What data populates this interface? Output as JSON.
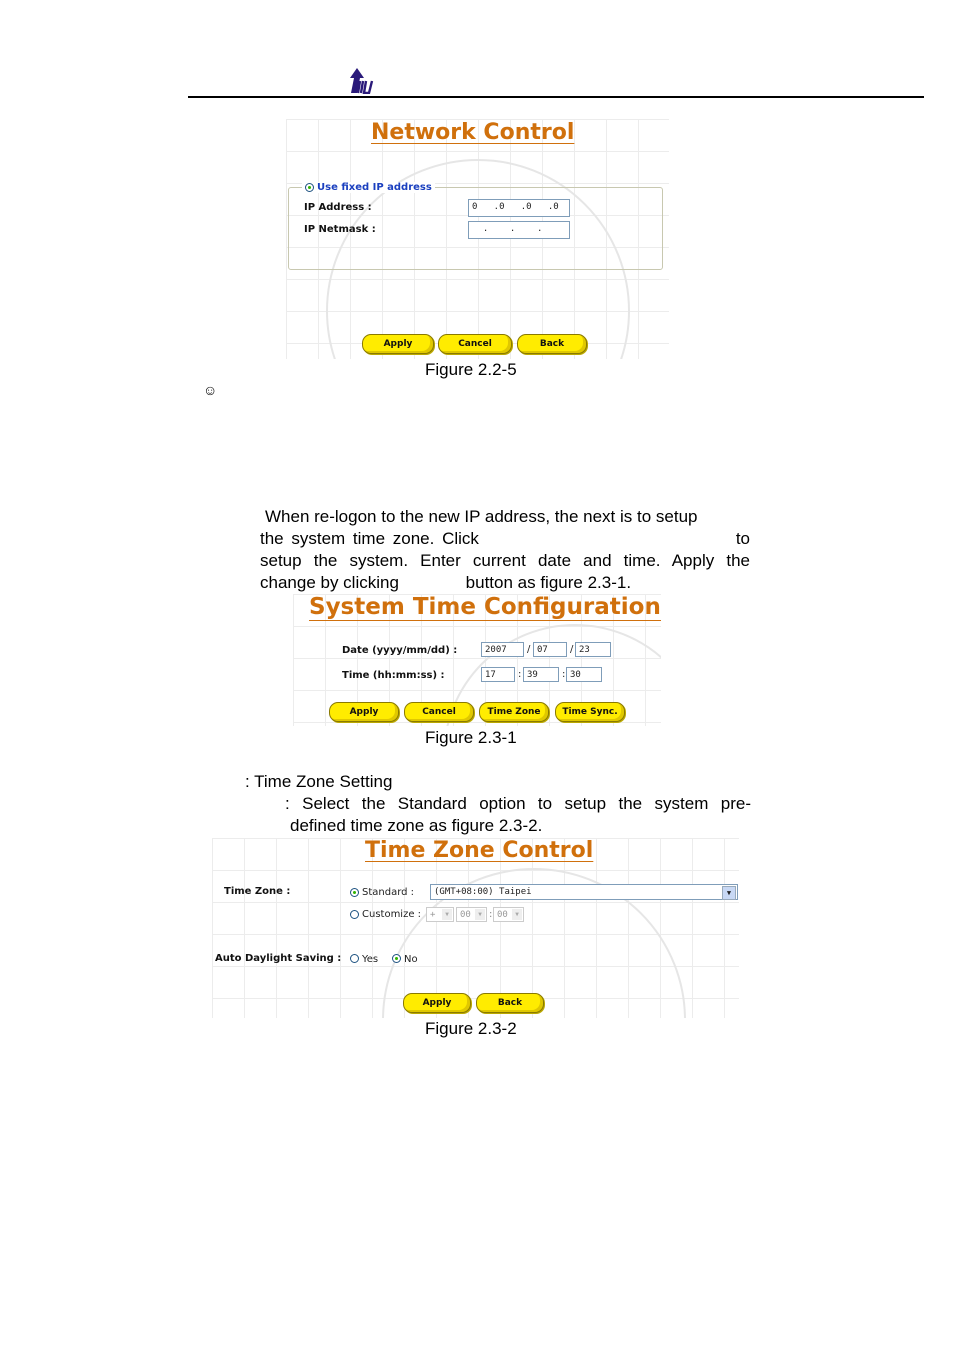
{
  "header": {
    "logo_icon": "tw-arrow-logo"
  },
  "figure_2_2_5": {
    "title": "Network Control",
    "fieldset_legend": "Use fixed IP address",
    "ip_address_label": "IP Address :",
    "ip_address_value": "0   .0   .0   .0",
    "ip_netmask_label": "IP Netmask :",
    "ip_netmask_value": "  .    .    .",
    "buttons": {
      "apply": "Apply",
      "cancel": "Cancel",
      "back": "Back"
    },
    "caption": "Figure 2.2-5"
  },
  "note_icon": "smiley-icon",
  "paragraph": {
    "line1": "When re-logon to the new IP address, the next is to setup",
    "line2a": "the system time zone. Click",
    "line2b": "to",
    "line3": "setup the system. Enter current date and time. Apply the",
    "line4a": "change by clicking",
    "line4b": "button as figure 2.3-1."
  },
  "figure_2_3_1": {
    "title": "System Time Configuration",
    "date_label": "Date (yyyy/mm/dd) :",
    "date": {
      "year": "2007",
      "month": "07",
      "day": "23"
    },
    "time_label": "Time (hh:mm:ss) :",
    "time": {
      "hour": "17",
      "minute": "39",
      "second": "30"
    },
    "date_sep": "/",
    "time_sep": ":",
    "buttons": {
      "apply": "Apply",
      "cancel": "Cancel",
      "time_zone": "Time Zone",
      "time_sync": "Time Sync."
    },
    "caption": "Figure 2.3-1"
  },
  "step": {
    "heading": ": Time Zone Setting",
    "line1": ": Select the Standard option to setup the system pre-",
    "line2": "defined time zone as figure 2.3-2."
  },
  "figure_2_3_2": {
    "title": "Time Zone Control",
    "time_zone_label": "Time Zone :",
    "standard_label": "Standard :",
    "standard_selected": "(GMT+08:00) Taipei",
    "customize_label": "Customize :",
    "customize_sign": "+",
    "customize_hours": "00",
    "customize_minutes": "00",
    "customize_sep": ":",
    "daylight_label": "Auto Daylight Saving :",
    "daylight_yes": "Yes",
    "daylight_no": "No",
    "buttons": {
      "apply": "Apply",
      "back": "Back"
    },
    "caption": "Figure 2.3-2"
  }
}
